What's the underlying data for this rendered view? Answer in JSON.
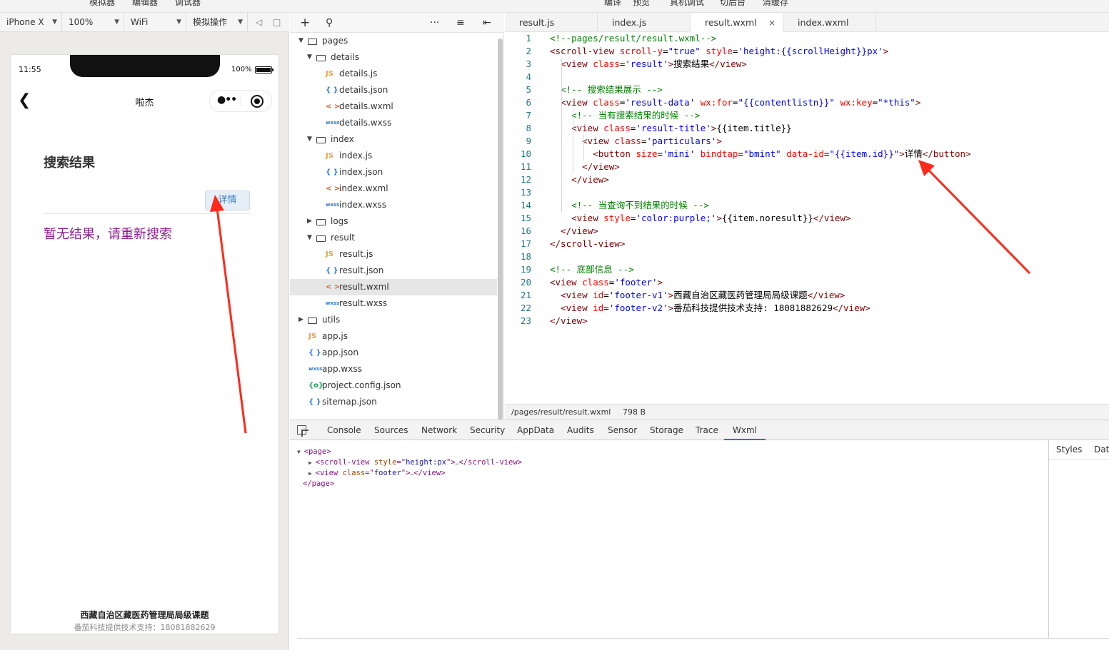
{
  "top_menu": {
    "simulator": "模拟器",
    "editor": "编辑器",
    "debugger": "调试器",
    "compile": "编译",
    "preview": "预览",
    "remote_debug": "真机调试",
    "background": "切后台",
    "clear_cache": "清缓存"
  },
  "sim_toolbar": {
    "device": "iPhone X",
    "zoom": "100%",
    "network": "WiFi",
    "operation": "模拟操作"
  },
  "phone": {
    "time": "11:55",
    "battery": "100%",
    "battery_level": 1.0,
    "nav_title": "啦杰",
    "heading": "搜索结果",
    "detail_button": "详情",
    "no_result": "暂无结果，请重新搜索",
    "footer_v1": "西藏自治区藏医药管理局局级课题",
    "footer_v2": "番茄科技提供技术支持：18081882629"
  },
  "file_tree": [
    {
      "label": "pages",
      "type": "folder",
      "depth": 0,
      "open": true
    },
    {
      "label": "details",
      "type": "folder",
      "depth": 1,
      "open": true
    },
    {
      "label": "details.js",
      "type": "js",
      "depth": 2
    },
    {
      "label": "details.json",
      "type": "json",
      "depth": 2
    },
    {
      "label": "details.wxml",
      "type": "wxml",
      "depth": 2
    },
    {
      "label": "details.wxss",
      "type": "wxss",
      "depth": 2
    },
    {
      "label": "index",
      "type": "folder",
      "depth": 1,
      "open": true
    },
    {
      "label": "index.js",
      "type": "js",
      "depth": 2
    },
    {
      "label": "index.json",
      "type": "json",
      "depth": 2
    },
    {
      "label": "index.wxml",
      "type": "wxml",
      "depth": 2
    },
    {
      "label": "index.wxss",
      "type": "wxss",
      "depth": 2
    },
    {
      "label": "logs",
      "type": "folder",
      "depth": 1,
      "open": false
    },
    {
      "label": "result",
      "type": "folder",
      "depth": 1,
      "open": true
    },
    {
      "label": "result.js",
      "type": "js",
      "depth": 2
    },
    {
      "label": "result.json",
      "type": "json",
      "depth": 2
    },
    {
      "label": "result.wxml",
      "type": "wxml",
      "depth": 2,
      "active": true
    },
    {
      "label": "result.wxss",
      "type": "wxss",
      "depth": 2
    },
    {
      "label": "utils",
      "type": "folder",
      "depth": 0,
      "open": false
    },
    {
      "label": "app.js",
      "type": "js",
      "depth": 0
    },
    {
      "label": "app.json",
      "type": "json",
      "depth": 0
    },
    {
      "label": "app.wxss",
      "type": "wxss",
      "depth": 0
    },
    {
      "label": "project.config.json",
      "type": "config",
      "depth": 0
    },
    {
      "label": "sitemap.json",
      "type": "json",
      "depth": 0
    }
  ],
  "icons": {
    "js": "JS",
    "json": "{ }",
    "wxml": "< >",
    "wxss": "wxss",
    "config": "{o}"
  },
  "editor_tabs": [
    {
      "label": "result.js"
    },
    {
      "label": "index.js"
    },
    {
      "label": "result.wxml",
      "active": true,
      "close": "×"
    },
    {
      "label": "index.wxml"
    }
  ],
  "code_lines": [
    [
      [
        "c",
        "<!--pages/result/result.wxml-->"
      ]
    ],
    [
      [
        "t",
        "<scroll-view "
      ],
      [
        "a",
        "scroll-y"
      ],
      [
        "x",
        "="
      ],
      [
        "v",
        "\"true\""
      ],
      [
        "x",
        " "
      ],
      [
        "a",
        "style"
      ],
      [
        "x",
        "="
      ],
      [
        "v",
        "'height:{{scrollHeight}}px'"
      ],
      [
        "t",
        ">"
      ]
    ],
    [
      [
        "x",
        "  "
      ],
      [
        "t",
        "<view "
      ],
      [
        "a",
        "class"
      ],
      [
        "x",
        "="
      ],
      [
        "v",
        "'result'"
      ],
      [
        "t",
        ">"
      ],
      [
        "x",
        "搜索结果"
      ],
      [
        "t",
        "</view>"
      ]
    ],
    [],
    [
      [
        "x",
        "  "
      ],
      [
        "c",
        "<!-- 搜索结果展示 -->"
      ]
    ],
    [
      [
        "x",
        "  "
      ],
      [
        "t",
        "<view "
      ],
      [
        "a",
        "class"
      ],
      [
        "x",
        "="
      ],
      [
        "v",
        "'result-data'"
      ],
      [
        "x",
        " "
      ],
      [
        "a",
        "wx:for"
      ],
      [
        "x",
        "="
      ],
      [
        "v",
        "\"{{contentlistn}}\""
      ],
      [
        "x",
        " "
      ],
      [
        "a",
        "wx:key"
      ],
      [
        "x",
        "="
      ],
      [
        "v",
        "\"*this\""
      ],
      [
        "t",
        ">"
      ]
    ],
    [
      [
        "x",
        "    "
      ],
      [
        "c",
        "<!-- 当有搜索结果的时候 -->"
      ]
    ],
    [
      [
        "x",
        "    "
      ],
      [
        "t",
        "<view "
      ],
      [
        "a",
        "class"
      ],
      [
        "x",
        "="
      ],
      [
        "v",
        "'result-title'"
      ],
      [
        "t",
        ">"
      ],
      [
        "x",
        "{{item.title}}"
      ]
    ],
    [
      [
        "x",
        "      "
      ],
      [
        "t",
        "<view "
      ],
      [
        "a",
        "class"
      ],
      [
        "x",
        "="
      ],
      [
        "v",
        "'particulars'"
      ],
      [
        "t",
        ">"
      ]
    ],
    [
      [
        "x",
        "        "
      ],
      [
        "t",
        "<button "
      ],
      [
        "a",
        "size"
      ],
      [
        "x",
        "="
      ],
      [
        "v",
        "'mini'"
      ],
      [
        "x",
        " "
      ],
      [
        "a",
        "bindtap"
      ],
      [
        "x",
        "="
      ],
      [
        "v",
        "\"bmint\""
      ],
      [
        "x",
        " "
      ],
      [
        "a",
        "data-id"
      ],
      [
        "x",
        "="
      ],
      [
        "v",
        "\"{{item.id}}\""
      ],
      [
        "t",
        ">"
      ],
      [
        "x",
        "详情"
      ],
      [
        "t",
        "</button>"
      ]
    ],
    [
      [
        "x",
        "      "
      ],
      [
        "t",
        "</view>"
      ]
    ],
    [
      [
        "x",
        "    "
      ],
      [
        "t",
        "</view>"
      ]
    ],
    [],
    [
      [
        "x",
        "    "
      ],
      [
        "c",
        "<!-- 当查询不到结果的时候 -->"
      ]
    ],
    [
      [
        "x",
        "    "
      ],
      [
        "t",
        "<view "
      ],
      [
        "a",
        "style"
      ],
      [
        "x",
        "="
      ],
      [
        "v",
        "'color:purple;'"
      ],
      [
        "t",
        ">"
      ],
      [
        "x",
        "{{item.noresult}}"
      ],
      [
        "t",
        "</view>"
      ]
    ],
    [
      [
        "x",
        "  "
      ],
      [
        "t",
        "</view>"
      ]
    ],
    [
      [
        "t",
        "</scroll-view>"
      ]
    ],
    [],
    [
      [
        "c",
        "<!-- 底部信息 -->"
      ]
    ],
    [
      [
        "t",
        "<view "
      ],
      [
        "a",
        "class"
      ],
      [
        "x",
        "="
      ],
      [
        "v",
        "'footer'"
      ],
      [
        "t",
        ">"
      ]
    ],
    [
      [
        "x",
        "  "
      ],
      [
        "t",
        "<view "
      ],
      [
        "a",
        "id"
      ],
      [
        "x",
        "="
      ],
      [
        "v",
        "'footer-v1'"
      ],
      [
        "t",
        ">"
      ],
      [
        "x",
        "西藏自治区藏医药管理局局级课题"
      ],
      [
        "t",
        "</view>"
      ]
    ],
    [
      [
        "x",
        "  "
      ],
      [
        "t",
        "<view "
      ],
      [
        "a",
        "id"
      ],
      [
        "x",
        "="
      ],
      [
        "v",
        "'footer-v2'"
      ],
      [
        "t",
        ">"
      ],
      [
        "x",
        "番茄科技提供技术支持: 18081882629"
      ],
      [
        "t",
        "</view>"
      ]
    ],
    [
      [
        "t",
        "</view>"
      ]
    ]
  ],
  "editor_status": {
    "path": "/pages/result/result.wxml",
    "size": "798 B"
  },
  "devtools": {
    "tabs": [
      "Console",
      "Sources",
      "Network",
      "Security",
      "AppData",
      "Audits",
      "Sensor",
      "Storage",
      "Trace",
      "Wxml"
    ],
    "active_tab": "Wxml",
    "dom_lines": [
      {
        "tw": "▼",
        "parts": [
          [
            "g",
            "<page>"
          ]
        ]
      },
      {
        "tw": "▶",
        "parts": [
          [
            "g",
            "<scroll-view "
          ],
          [
            "a",
            "style"
          ],
          [
            "g",
            "=\""
          ],
          [
            "v",
            "height:px"
          ],
          [
            "g",
            "\">"
          ],
          [
            "x",
            "…"
          ],
          [
            "g",
            "</scroll-view>"
          ]
        ]
      },
      {
        "tw": "▶",
        "parts": [
          [
            "g",
            "<view "
          ],
          [
            "a",
            "class"
          ],
          [
            "g",
            "=\""
          ],
          [
            "v",
            "footer"
          ],
          [
            "g",
            "\">"
          ],
          [
            "x",
            "…"
          ],
          [
            "g",
            "</view>"
          ]
        ]
      },
      {
        "tw": "",
        "parts": [
          [
            "g",
            "</page>"
          ]
        ]
      }
    ],
    "side_tabs": [
      "Styles",
      "Data"
    ],
    "colors": {
      "arrow": "#ff2a1a",
      "active_tab_underline": "#1a73e8"
    }
  }
}
